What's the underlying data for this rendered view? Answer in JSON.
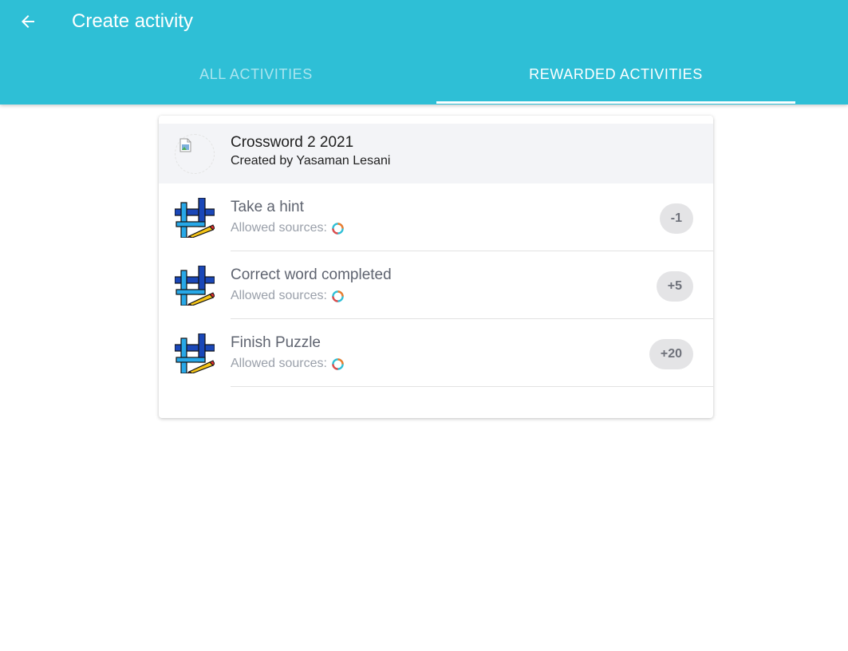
{
  "header": {
    "back_icon": "arrow-left-icon",
    "title": "Create activity",
    "tabs": [
      {
        "label": "ALL ACTIVITIES",
        "active": false
      },
      {
        "label": "REWARDED ACTIVITIES",
        "active": true
      }
    ],
    "color": "#2ebfd6"
  },
  "game": {
    "title": "Crossword 2 2021",
    "creator": "Created by Yasaman Lesani",
    "image": "broken-image-icon"
  },
  "activities": [
    {
      "name": "Take a hint",
      "sources_label": "Allowed sources:",
      "points": "-1",
      "icon": "crossword-pencil-icon"
    },
    {
      "name": "Correct word completed",
      "sources_label": "Allowed sources:",
      "points": "+5",
      "icon": "crossword-pencil-icon"
    },
    {
      "name": "Finish Puzzle",
      "sources_label": "Allowed sources:",
      "points": "+20",
      "icon": "crossword-pencil-icon"
    }
  ]
}
